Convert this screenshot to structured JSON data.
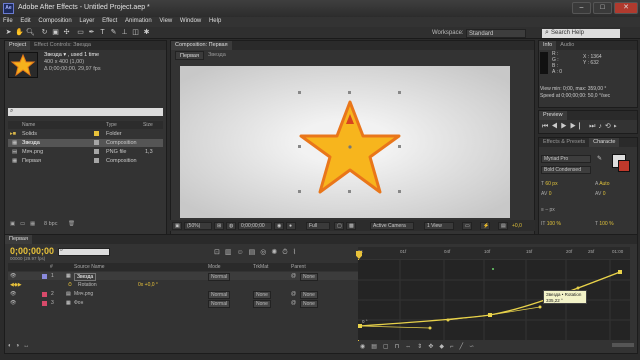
{
  "app": {
    "logo": "Ae",
    "title": "Adobe After Effects - Untitled Project.aep *"
  },
  "window_controls": {
    "minimize": "–",
    "maximize": "□",
    "close": "✕"
  },
  "menu": [
    "File",
    "Edit",
    "Composition",
    "Layer",
    "Effect",
    "Animation",
    "View",
    "Window",
    "Help"
  ],
  "tools": [
    "arrow-icon",
    "hand-icon",
    "zoom-icon",
    "rotate-icon",
    "camera-icon",
    "pan-icon",
    "rect-icon",
    "pen-icon",
    "text-icon",
    "brush-icon",
    "stamp-icon",
    "eraser-icon",
    "puppet-icon"
  ],
  "workspace": {
    "label": "Workspace:",
    "value": "Standard"
  },
  "help_search": {
    "placeholder": "Search Help"
  },
  "project": {
    "tab_project": "Project",
    "tab_effect_controls": "Effect Controls: Звезда",
    "asset_name": "Звезда ▾ , used 1 time",
    "asset_size": "400 x 400 (1,00)",
    "asset_duration": "Δ 0;00;00;00, 29,97 fps",
    "search_placeholder": "",
    "headers": {
      "name": "Name",
      "type": "Type",
      "size": "Size"
    },
    "items": [
      {
        "name": "Solids",
        "type": "Folder",
        "size": "",
        "color": "#e8c23a"
      },
      {
        "name": "Звезда",
        "type": "Composition",
        "size": "",
        "color": "#a6a6a6",
        "selected": true
      },
      {
        "name": "Мяч.png",
        "type": "PNG file",
        "size": "1,3",
        "color": "#a6a6a6"
      },
      {
        "name": "Первая",
        "type": "Composition",
        "size": "",
        "color": "#a6a6a6"
      }
    ],
    "bpc": "8 bpc"
  },
  "composition": {
    "tab": "Composition: Первая",
    "sub_tabs": [
      "Первая",
      "Звезда"
    ],
    "zoom": "(50%)",
    "time": "0;00;00;00",
    "resolution": "Full",
    "camera": "Active Camera",
    "views": "1 View",
    "exposure": "+0,0"
  },
  "info": {
    "tab": "Info",
    "audio_tab": "Audio",
    "r": "R :",
    "g": "G :",
    "b": "B :",
    "a": "A : 0",
    "x": "X : 1364",
    "y": "Y : 632",
    "view_min": "View min: 0;00, max: 359,00 °",
    "speed": "Speed at 0;00;00;00: 50,0 °/sec"
  },
  "preview": {
    "tab": "Preview"
  },
  "effects": {
    "tab": "Effects & Presets",
    "char_tab": "Characte",
    "font": "Myriad Pro",
    "style": "Bold Condensed",
    "size": "60 px",
    "leading": "Auto",
    "kerning": "0",
    "tracking": "0",
    "stroke": "– px",
    "scale_v": "100 %",
    "scale_h": "100 %"
  },
  "timeline": {
    "tab": "Первая",
    "timecode": "0;00;00;00",
    "frame_info": "00000 (29.97 fps)",
    "headers": {
      "num": "#",
      "source": "Source Name",
      "mode": "Mode",
      "trkmat": "TrkMat",
      "parent": "Parent"
    },
    "layers": [
      {
        "num": "1",
        "name": "Звезда",
        "mode": "Normal",
        "trk": "",
        "parent": "None",
        "color": "#8a8adc"
      },
      {
        "num": "2",
        "name": "Мяч.png",
        "mode": "Normal",
        "trk": "None",
        "parent": "None",
        "color": "#d84a6a"
      },
      {
        "num": "3",
        "name": "Фон",
        "mode": "Normal",
        "trk": "None",
        "parent": "None",
        "color": "#d84a6a"
      }
    ],
    "rotation": {
      "label": "Rotation",
      "value": "0x +0,0 °"
    },
    "ruler": [
      "0s",
      "01f",
      "04f",
      "10f",
      "15f",
      "20f",
      "25f",
      "01:00"
    ],
    "tooltip": {
      "line1": "Звезда • Rotation",
      "line2": "335,22 °"
    },
    "graph_label": "0 °"
  }
}
